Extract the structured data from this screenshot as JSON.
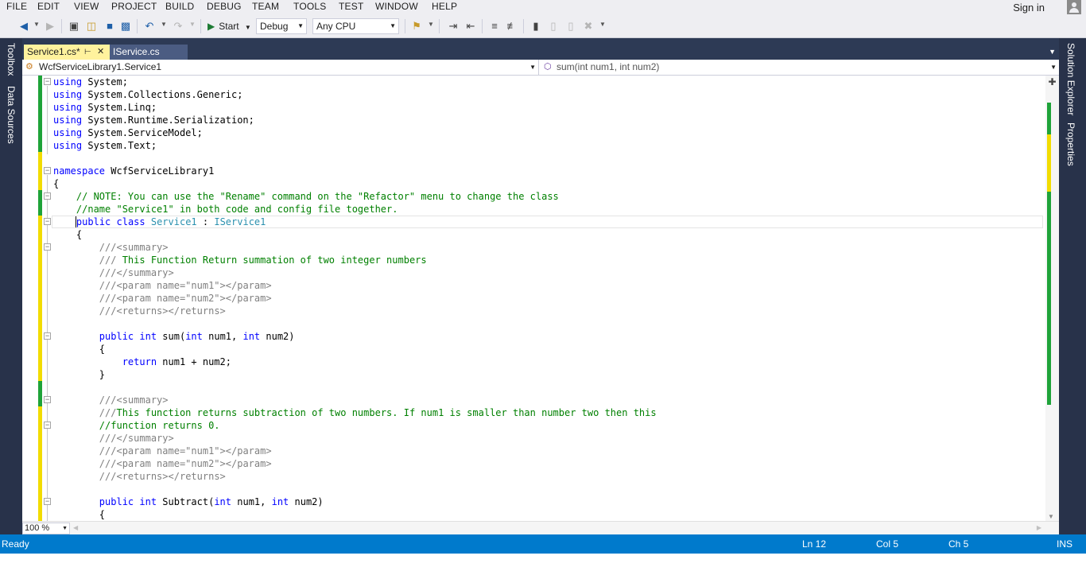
{
  "menu": {
    "items": [
      "FILE",
      "EDIT",
      "VIEW",
      "PROJECT",
      "BUILD",
      "DEBUG",
      "TEAM",
      "TOOLS",
      "TEST",
      "WINDOW",
      "HELP"
    ],
    "sign_in": "Sign in"
  },
  "toolbar": {
    "start_label": "Start",
    "configuration": "Debug",
    "platform": "Any CPU",
    "icons": [
      "back-icon",
      "forward-icon",
      "new-project-icon",
      "open-file-icon",
      "save-icon",
      "save-all-icon",
      "undo-icon",
      "redo-icon",
      "start-icon",
      "find-icon",
      "step-icon",
      "comment-icon",
      "bookmark-icon"
    ]
  },
  "side_tabs": {
    "left": [
      "Toolbox",
      "Data Sources"
    ],
    "right": [
      "Solution Explorer",
      "Properties"
    ]
  },
  "tabs": [
    {
      "label": "Service1.cs*",
      "active": true
    },
    {
      "label": "IService.cs",
      "active": false
    }
  ],
  "navbar": {
    "type_selector": "WcfServiceLibrary1.Service1",
    "member_selector": "sum(int num1, int num2)"
  },
  "editor": {
    "lines": [
      "using System;",
      "using System.Collections.Generic;",
      "using System.Linq;",
      "using System.Runtime.Serialization;",
      "using System.ServiceModel;",
      "using System.Text;",
      "",
      "namespace WcfServiceLibrary1",
      "{",
      "    // NOTE: You can use the \"Rename\" command on the \"Refactor\" menu to change the class",
      "    //name \"Service1\" in both code and config file together.",
      "    public class Service1 : IService1",
      "    {",
      "        ///<summary>",
      "        /// This Function Return summation of two integer numbers",
      "        ///</summary>",
      "        ///<param name=\"num1\"></param>",
      "        ///<param name=\"num2\"></param>",
      "        ///<returns></returns>",
      "",
      "        public int sum(int num1, int num2)",
      "        {",
      "            return num1 + num2;",
      "        }",
      "",
      "        ///<summary>",
      "        ///This function returns subtraction of two numbers. If num1 is smaller than number two then this",
      "        //function returns 0.",
      "        ///</summary>",
      "        ///<param name=\"num1\"></param>",
      "        ///<param name=\"num2\"></param>",
      "        ///<returns></returns>",
      "",
      "        public int Subtract(int num1, int num2)",
      "        {"
    ]
  },
  "zoom": "100 %",
  "status": {
    "state": "Ready",
    "line": "Ln 12",
    "col": "Col 5",
    "ch": "Ch 5",
    "mode": "INS"
  },
  "colors": {
    "keyword": "#0000ff",
    "type": "#2b91af",
    "comment": "#008000",
    "statusbar": "#007acc",
    "active_tab": "#fff29d",
    "change_saved": "#1fa339",
    "change_unsaved": "#f2dc00"
  }
}
